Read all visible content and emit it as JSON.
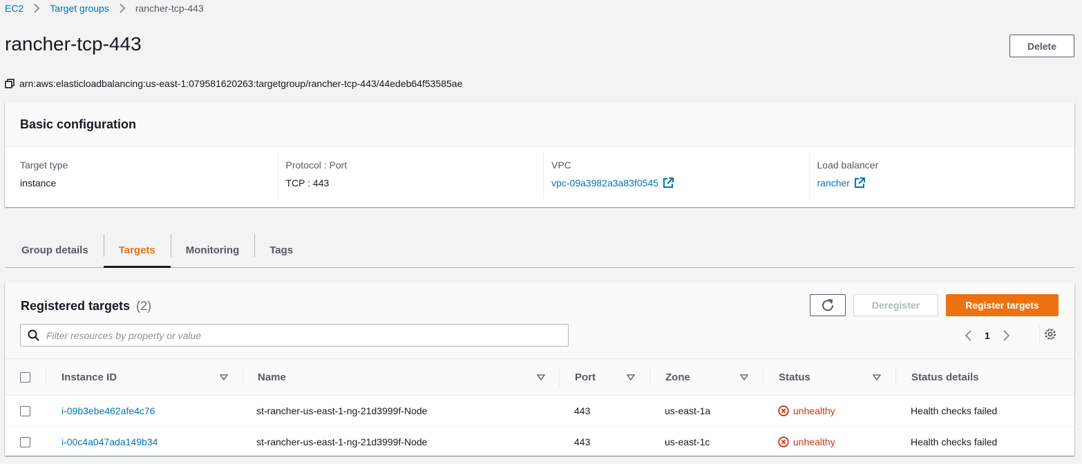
{
  "breadcrumb": {
    "items": [
      "EC2",
      "Target groups"
    ],
    "current": "rancher-tcp-443"
  },
  "page": {
    "title": "rancher-tcp-443",
    "delete_label": "Delete",
    "arn": "arn:aws:elasticloadbalancing:us-east-1:079581620263:targetgroup/rancher-tcp-443/44edeb64f53585ae"
  },
  "basic_config": {
    "title": "Basic configuration",
    "columns": [
      {
        "label": "Target type",
        "value": "instance"
      },
      {
        "label": "Protocol : Port",
        "value": "TCP : 443"
      },
      {
        "label": "VPC",
        "value": "vpc-09a3982a3a83f0545"
      },
      {
        "label": "Load balancer",
        "value": "rancher"
      }
    ]
  },
  "tabs": [
    {
      "label": "Group details"
    },
    {
      "label": "Targets"
    },
    {
      "label": "Monitoring"
    },
    {
      "label": "Tags"
    }
  ],
  "active_tab": "Targets",
  "targets": {
    "title": "Registered targets",
    "count": "(2)",
    "deregister_label": "Deregister",
    "register_label": "Register targets",
    "filter_placeholder": "Filter resources by property or value",
    "page": "1",
    "columns": [
      "Instance ID",
      "Name",
      "Port",
      "Zone",
      "Status",
      "Status details"
    ],
    "rows": [
      {
        "instance_id": "i-09b3ebe462afe4c76",
        "name": "st-rancher-us-east-1-ng-21d3999f-Node",
        "port": "443",
        "zone": "us-east-1a",
        "status": "unhealthy",
        "status_details": "Health checks failed"
      },
      {
        "instance_id": "i-00c4a047ada149b34",
        "name": "st-rancher-us-east-1-ng-21d3999f-Node",
        "port": "443",
        "zone": "us-east-1c",
        "status": "unhealthy",
        "status_details": "Health checks failed"
      }
    ]
  },
  "colors": {
    "link": "#0073bb",
    "accent_orange": "#ec7211",
    "error_red": "#d13212",
    "background": "#f2f3f3"
  }
}
